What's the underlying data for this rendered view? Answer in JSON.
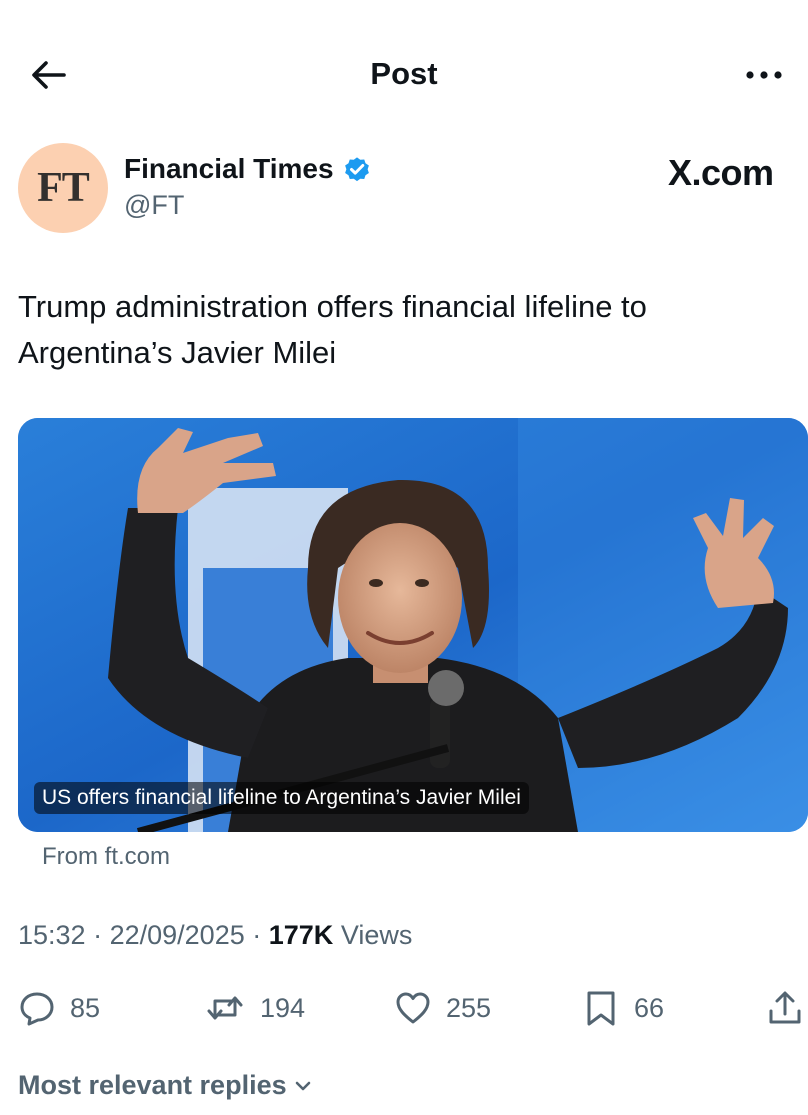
{
  "header": {
    "title": "Post",
    "back_icon": "arrow-left-icon",
    "more_icon": "more-horizontal-icon"
  },
  "author": {
    "avatar_text": "FT",
    "avatar_color": "#fcd0b1",
    "name": "Financial Times",
    "handle": "@FT",
    "verified_color": "#1d9bf0"
  },
  "watermark": "X.com",
  "post": {
    "text": "Trump administration offers financial lifeline to Argentina’s Javier Milei"
  },
  "card": {
    "caption": "US offers financial lifeline to Argentina’s Javier Milei",
    "source": "From ft.com"
  },
  "meta": {
    "time": "15:32",
    "date": "22/09/2025",
    "views_count": "177K",
    "views_label": "Views"
  },
  "actions": {
    "replies": "85",
    "reposts": "194",
    "likes": "255",
    "bookmarks": "66"
  },
  "replies_header": {
    "label": "Most relevant replies"
  },
  "colors": {
    "text_primary": "#0f1419",
    "text_secondary": "#536471",
    "accent": "#1d9bf0"
  }
}
